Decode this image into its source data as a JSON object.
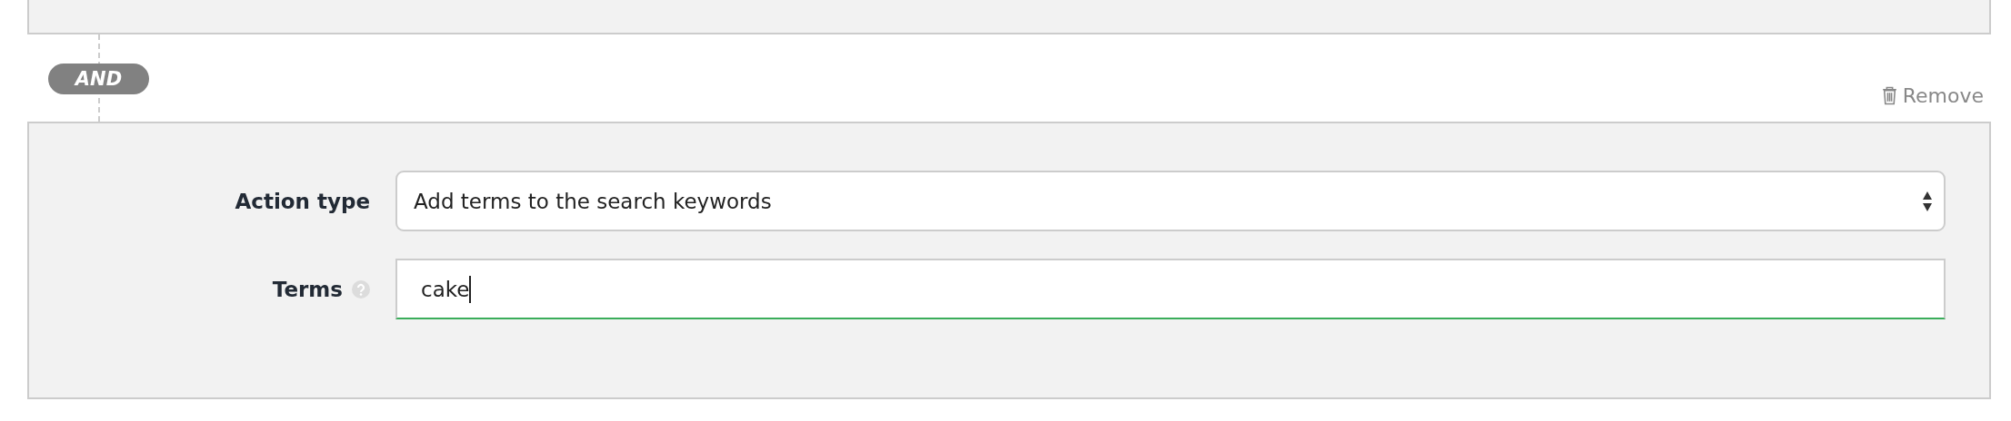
{
  "connector": {
    "label": "AND"
  },
  "remove_link": {
    "label": "Remove"
  },
  "fields": [
    {
      "kind": "select",
      "label": "Action type",
      "help": false,
      "value": "Add terms to the search keywords",
      "focused": false
    },
    {
      "kind": "text",
      "label": "Terms",
      "help": true,
      "value": "cake",
      "focused": true
    }
  ]
}
